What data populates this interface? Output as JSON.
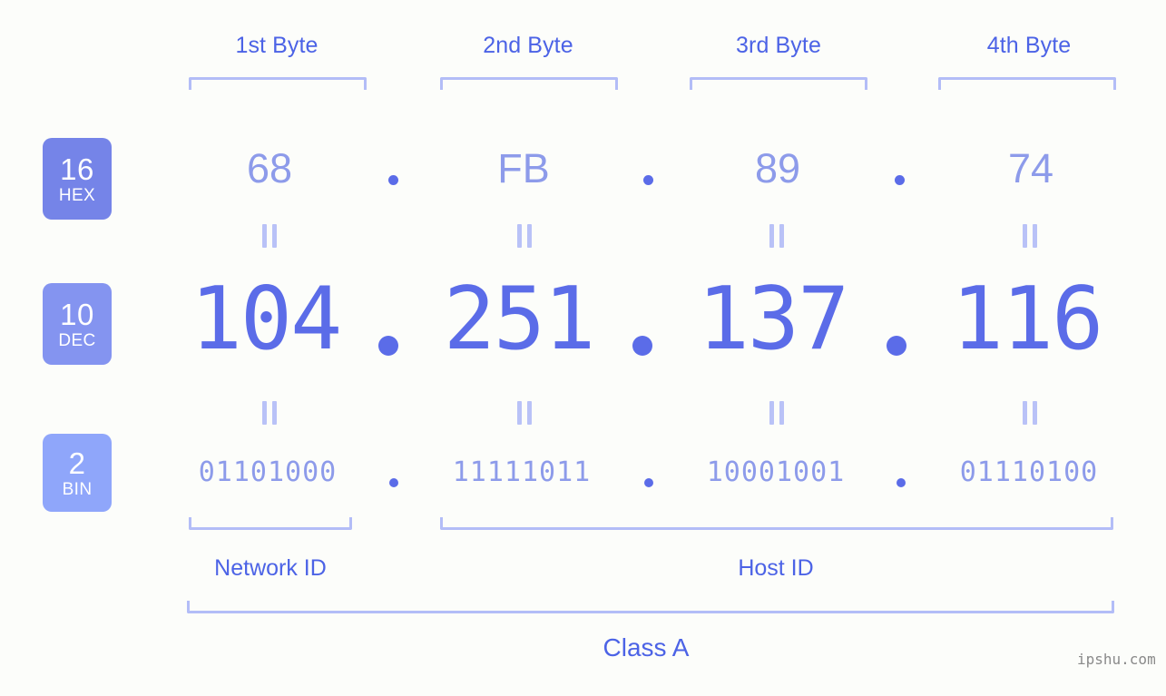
{
  "page": {
    "background_color": "#fcfdfa",
    "accent_color": "#4c63e6",
    "value_color": "#5b6ce8",
    "muted_color": "#8d9bea",
    "bracket_color": "#b3bdf7"
  },
  "byte_headers": [
    {
      "label": "1st Byte"
    },
    {
      "label": "2nd Byte"
    },
    {
      "label": "3rd Byte"
    },
    {
      "label": "4th Byte"
    }
  ],
  "rows": {
    "hex": {
      "badge_number": "16",
      "badge_name": "HEX",
      "badge_color": "#7584e8",
      "values": [
        "68",
        "FB",
        "89",
        "74"
      ],
      "separator": "."
    },
    "dec": {
      "badge_number": "10",
      "badge_name": "DEC",
      "badge_color": "#8494f0",
      "values": [
        "104",
        "251",
        "137",
        "116"
      ],
      "separator": "."
    },
    "bin": {
      "badge_number": "2",
      "badge_name": "BIN",
      "badge_color": "#8fa6fa",
      "values": [
        "01101000",
        "11111011",
        "10001001",
        "01110100"
      ],
      "separator": "."
    }
  },
  "equality_symbol": "=",
  "segments": {
    "network_id_label": "Network ID",
    "host_id_label": "Host ID",
    "class_label": "Class A"
  },
  "watermark": {
    "text": "ipshu.com"
  }
}
